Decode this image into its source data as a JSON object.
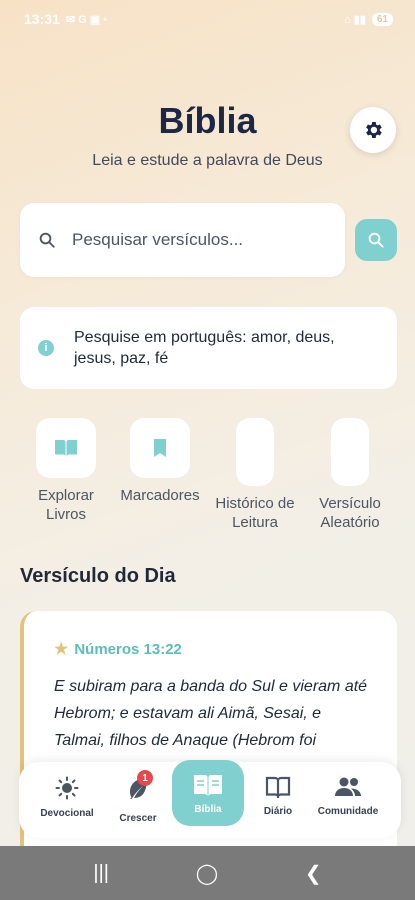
{
  "status": {
    "time": "13:31",
    "indicators": "✉ G ▣ •",
    "network": "⌂ ▮▮",
    "battery": "61"
  },
  "header": {
    "title": "Bíblia",
    "subtitle": "Leia e estude a palavra de Deus"
  },
  "search": {
    "placeholder": "Pesquisar versículos..."
  },
  "info": {
    "text": "Pesquise em português: amor, deus, jesus, paz, fé"
  },
  "quick_actions": [
    {
      "label": "Explorar Livros",
      "icon": "book-open-icon"
    },
    {
      "label": "Marcadores",
      "icon": "bookmark-icon"
    },
    {
      "label": "Histórico de Leitura",
      "icon": "history-icon"
    },
    {
      "label": "Versículo Aleatório",
      "icon": "shuffle-icon"
    }
  ],
  "verse_of_day": {
    "section_title": "Versículo do Dia",
    "reference": "Números 13:22",
    "text": "E subiram para a banda do Sul e vieram até Hebrom; e estavam ali Aimã, Sesai, e Talmai, filhos de Anaque (Hebrom foi"
  },
  "bottom_nav": [
    {
      "label": "Devocional",
      "icon": "sun-icon"
    },
    {
      "label": "Crescer",
      "icon": "leaf-icon",
      "badge": "1"
    },
    {
      "label": "Bíblia",
      "icon": "book-icon",
      "active": true
    },
    {
      "label": "Diário",
      "icon": "journal-icon"
    },
    {
      "label": "Comunidade",
      "icon": "people-icon"
    }
  ],
  "colors": {
    "accent": "#7fd0cf",
    "gold": "#e3c27d",
    "title": "#1b2745",
    "badge": "#e5484d"
  }
}
